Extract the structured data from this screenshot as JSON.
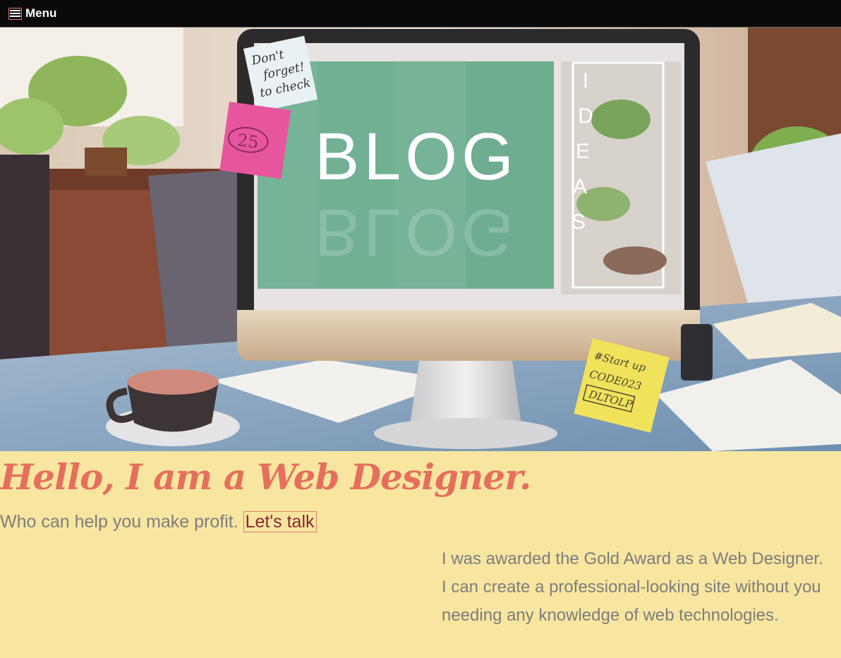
{
  "nav": {
    "menu_label": "Menu",
    "menu_icon": "hamburger-icon"
  },
  "hero": {
    "screen_text": "BLOG",
    "side_text": [
      "I",
      "D",
      "E",
      "A",
      "S"
    ],
    "note_top": [
      "Don't",
      "forget!",
      "to check"
    ],
    "note_pink": "25",
    "note_yellow": [
      "#Start up",
      "CODE023",
      "DLTOLP"
    ]
  },
  "intro": {
    "headline": "Hello, I am a Web Designer.",
    "tagline": "Who can help you make profit.",
    "cta_label": "Let's talk"
  },
  "about": {
    "text": "I was awarded the Gold Award as a Web Designer. I can create a professional-looking site without you needing any knowledge of web technologies."
  },
  "colors": {
    "background": "#f8e6a0",
    "accent": "#e56f5c",
    "topbar": "#0a0a0a",
    "text": "#7d7d7d"
  }
}
